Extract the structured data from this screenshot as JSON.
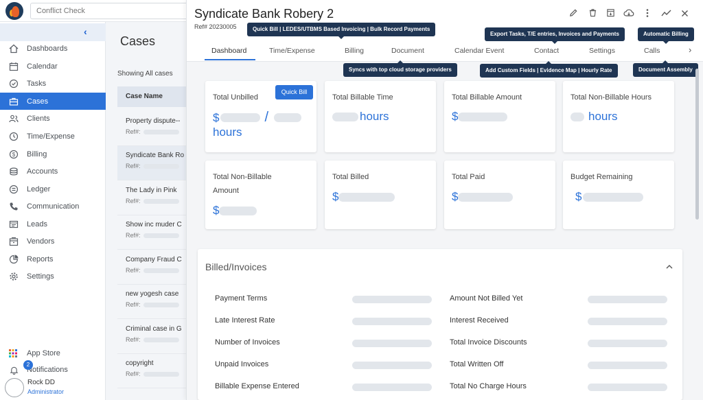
{
  "topbar": {
    "search_placeholder": "Conflict Check"
  },
  "sidebar": {
    "collapse_icon": "chevron-left-icon",
    "items": [
      {
        "label": "Dashboards",
        "icon": "home-icon",
        "active": false
      },
      {
        "label": "Calendar",
        "icon": "calendar-icon",
        "active": false
      },
      {
        "label": "Tasks",
        "icon": "check-circle-icon",
        "active": false
      },
      {
        "label": "Cases",
        "icon": "briefcase-icon",
        "active": true
      },
      {
        "label": "Clients",
        "icon": "users-icon",
        "active": false
      },
      {
        "label": "Time/Expense",
        "icon": "clock-icon",
        "active": false
      },
      {
        "label": "Billing",
        "icon": "dollar-icon",
        "active": false
      },
      {
        "label": "Accounts",
        "icon": "coins-icon",
        "active": false
      },
      {
        "label": "Ledger",
        "icon": "ledger-icon",
        "active": false
      },
      {
        "label": "Communication",
        "icon": "phone-icon",
        "active": false
      },
      {
        "label": "Leads",
        "icon": "leads-icon",
        "active": false
      },
      {
        "label": "Vendors",
        "icon": "vendors-icon",
        "active": false
      },
      {
        "label": "Reports",
        "icon": "chart-icon",
        "active": false
      },
      {
        "label": "Settings",
        "icon": "gear-icon",
        "active": false
      }
    ],
    "app_store": "App Store",
    "notifications": "Notifications",
    "notification_count": "2",
    "user": {
      "name": "Rock DD",
      "role": "Administrator"
    }
  },
  "cases_panel": {
    "title": "Cases",
    "showing": "Showing All cases",
    "column_header": "Case Name",
    "ref_label": "Ref#:",
    "items": [
      {
        "name": "Property dispute--",
        "selected": false
      },
      {
        "name": "Syndicate Bank Ro",
        "selected": true
      },
      {
        "name": "The Lady in Pink",
        "selected": false
      },
      {
        "name": "Show inc muder C",
        "selected": false
      },
      {
        "name": "Company Fraud C",
        "selected": false
      },
      {
        "name": "new yogesh case",
        "selected": false
      },
      {
        "name": "Criminal case in G",
        "selected": false
      },
      {
        "name": "copyright",
        "selected": false
      }
    ]
  },
  "detail": {
    "title": "Syndicate Bank Robery 2",
    "ref": "Ref# 20230005",
    "toolbar_icons": [
      "pencil-icon",
      "trash-icon",
      "archive-icon",
      "cloud-download-icon",
      "more-vertical-icon",
      "trend-icon",
      "close-icon"
    ],
    "tabs": [
      "Dashboard",
      "Time/Expense",
      "Billing",
      "Document",
      "Calendar Event",
      "Contact",
      "Settings",
      "Calls"
    ],
    "active_tab": "Dashboard",
    "tooltips": {
      "quick_bill": "Quick Bill | LEDES/UTBMS Based Invoicing | Bulk Record Payments",
      "export": "Export Tasks, T/E entries, Invoices and Payments",
      "automatic_billing": "Automatic Billing",
      "document_sync": "Syncs with top cloud storage providers",
      "custom_fields": "Add Custom Fields | Evidence Map | Hourly Rate",
      "document_assembly": "Document Assembly"
    },
    "cards": [
      {
        "title": "Total Unbilled",
        "value_prefix": "$",
        "separator": "/",
        "unit": "hours",
        "button": "Quick Bill"
      },
      {
        "title": "Total Billable Time",
        "unit": "hours"
      },
      {
        "title": "Total Billable Amount",
        "value_prefix": "$"
      },
      {
        "title": "Total Non-Billable Hours",
        "unit": "hours"
      },
      {
        "title": "Total Non-Billable Amount",
        "value_prefix": "$"
      },
      {
        "title": "Total Billed",
        "value_prefix": "$"
      },
      {
        "title": "Total Paid",
        "value_prefix": "$"
      },
      {
        "title": "Budget Remaining",
        "value_prefix": "$"
      }
    ],
    "billed_section": {
      "title": "Billed/Invoices",
      "left_rows": [
        "Payment Terms",
        "Late Interest Rate",
        "Number of Invoices",
        "Unpaid Invoices",
        "Billable Expense Entered"
      ],
      "right_rows": [
        "Amount Not Billed Yet",
        "Interest Received",
        "Total Invoice Discounts",
        "Total Written Off",
        "Total No Charge Hours"
      ]
    }
  }
}
